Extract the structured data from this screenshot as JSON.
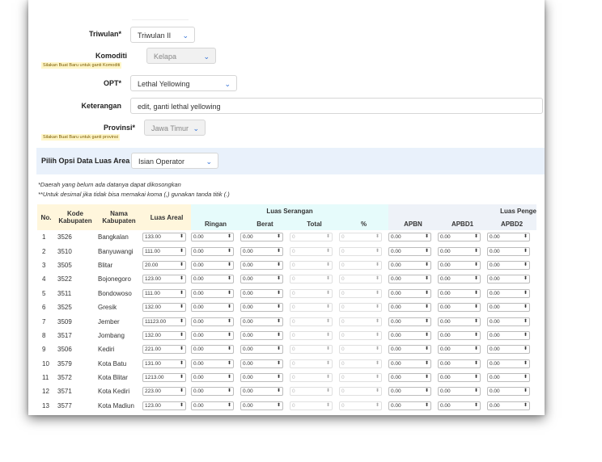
{
  "form": {
    "triwulan": {
      "label": "Triwulan*",
      "value": "Triwulan II"
    },
    "komoditi": {
      "label": "Komoditi",
      "value": "Kelapa",
      "warning": "Silakan Buat Baru untuk ganti Komoditi"
    },
    "opt": {
      "label": "OPT*",
      "value": "Lethal Yellowing"
    },
    "keterangan": {
      "label": "Keterangan",
      "value": "edit, ganti lethal yellowing"
    },
    "provinsi": {
      "label": "Provinsi*",
      "value": "Jawa Timur",
      "warning": "Silakan Buat Baru untuk ganti provinsi"
    },
    "luas_area": {
      "label": "Pilih Opsi Data Luas Area",
      "value": "Isian Operator"
    }
  },
  "notes": [
    "*Daerah yang belum ada datanya dapat dikosongkan",
    "**Untuk desimal jika tidak bisa memakai koma (,) gunakan tanda titik (.)"
  ],
  "table": {
    "headers": {
      "no": "No.",
      "kode": "Kode Kabupaten",
      "nama": "Nama Kabupaten",
      "luas": "Luas Areal",
      "serangan_group": "Luas Serangan",
      "ringan": "Ringan",
      "berat": "Berat",
      "total": "Total",
      "persen": "%",
      "pengendalian_group": "Luas Penge",
      "apbn": "APBN",
      "apbd1": "APBD1",
      "apbd2": "APBD2"
    },
    "rows": [
      {
        "no": "1",
        "kode": "3526",
        "nama": "Bangkalan",
        "luas": "133.00"
      },
      {
        "no": "2",
        "kode": "3510",
        "nama": "Banyuwangi",
        "luas": "111.00"
      },
      {
        "no": "3",
        "kode": "3505",
        "nama": "Blitar",
        "luas": "20.00"
      },
      {
        "no": "4",
        "kode": "3522",
        "nama": "Bojonegoro",
        "luas": "123.00"
      },
      {
        "no": "5",
        "kode": "3511",
        "nama": "Bondowoso",
        "luas": "111.00"
      },
      {
        "no": "6",
        "kode": "3525",
        "nama": "Gresik",
        "luas": "132.00"
      },
      {
        "no": "7",
        "kode": "3509",
        "nama": "Jember",
        "luas": "11123.00"
      },
      {
        "no": "8",
        "kode": "3517",
        "nama": "Jombang",
        "luas": "132.00"
      },
      {
        "no": "9",
        "kode": "3506",
        "nama": "Kediri",
        "luas": "221.00"
      },
      {
        "no": "10",
        "kode": "3579",
        "nama": "Kota Batu",
        "luas": "131.00"
      },
      {
        "no": "11",
        "kode": "3572",
        "nama": "Kota Blitar",
        "luas": "1213.00"
      },
      {
        "no": "12",
        "kode": "3571",
        "nama": "Kota Kediri",
        "luas": "223.00"
      },
      {
        "no": "13",
        "kode": "3577",
        "nama": "Kota Madiun",
        "luas": "123.00"
      }
    ],
    "default_decimal": "0.00",
    "default_zero": "0"
  },
  "colors": {
    "accent": "#2f6fd6",
    "option_bar": "#e9f1fb",
    "header_yellow": "#fff6dc",
    "header_cyan": "#e6fbfb"
  },
  "icons": {
    "dropdown": "chevron-down-icon",
    "spinner": "spinner-arrows-icon"
  }
}
